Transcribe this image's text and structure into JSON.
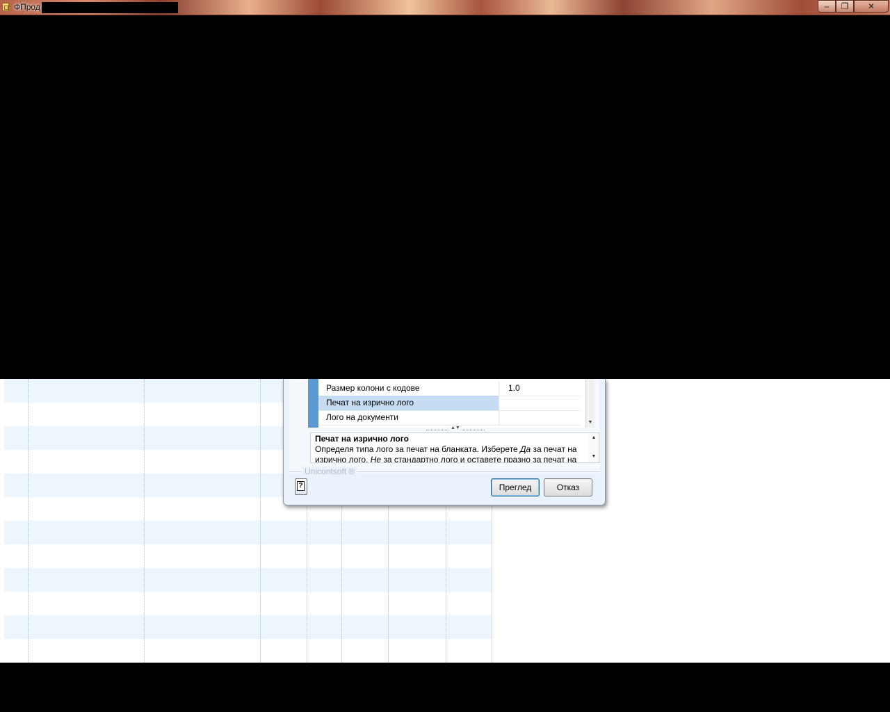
{
  "window": {
    "title": "ФПрод",
    "controls": {
      "minimize": "–",
      "maximize": "❐",
      "close": "✕"
    }
  },
  "dialog": {
    "properties": [
      {
        "name": "Размер колони с кодове",
        "value": "1.0"
      },
      {
        "name": "Печат на изрично лого",
        "value": "",
        "selected": true
      },
      {
        "name": "Лого на документи",
        "value": ""
      }
    ],
    "splitter_arrows": "▲▼",
    "description": {
      "title": "Печат на изрично лого",
      "text_part1": "Определя типа лого за печат на бланката. Изберете ",
      "text_em1": "Да",
      "text_part2": " за печат на изрично лого, ",
      "text_em2": "Не",
      "text_part3": " за стандартно лого и оставете празно за печат на"
    },
    "brand": "Unicontsoft ®",
    "help_icon": "?",
    "buttons": {
      "preview": "Преглед",
      "cancel": "Отказ"
    }
  },
  "colors": {
    "selection": "#c5dcf2",
    "gutter": "#5b9ad0",
    "grid_alt_row": "#eef6fd"
  }
}
